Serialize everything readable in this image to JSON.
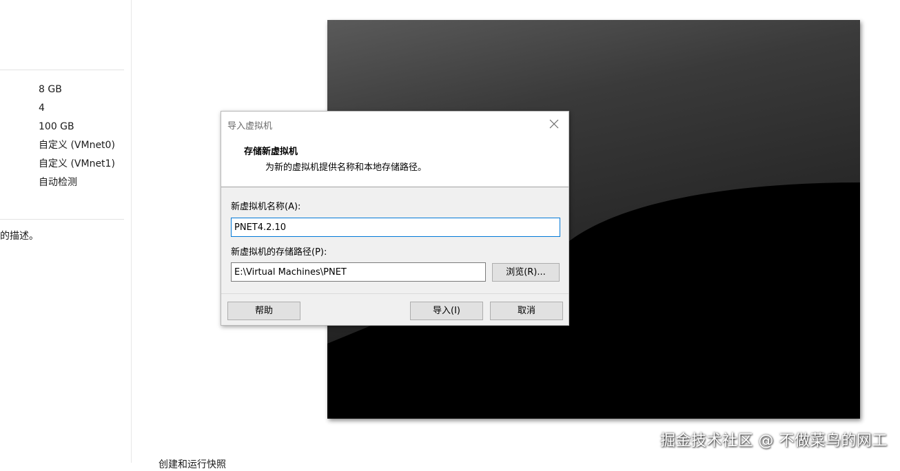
{
  "background_panel": {
    "specs": [
      "8 GB",
      "4",
      "100 GB",
      "自定义 (VMnet0)",
      "自定义 (VMnet1)",
      "自动检测"
    ],
    "description_fragment": "的描述。",
    "bottom_fragment": "创建和运行快照"
  },
  "vm_preview": {
    "icon": "vm-screen-preview"
  },
  "dialog": {
    "title": "导入虚拟机",
    "heading": "存储新虚拟机",
    "subheading": "为新的虚拟机提供名称和本地存储路径。",
    "name_label": "新虚拟机名称(A):",
    "name_value": "PNET4.2.10",
    "path_label": "新虚拟机的存储路径(P):",
    "path_value": "E:\\Virtual Machines\\PNET",
    "browse_label": "浏览(R)...",
    "help_label": "帮助",
    "import_label": "导入(I)",
    "cancel_label": "取消",
    "close_icon": "close-icon"
  },
  "watermark": "掘金技术社区 @ 不做菜鸟的网工",
  "colors": {
    "dialog_bg": "#f0f0f0",
    "focus_border": "#0078d7",
    "button_bg": "#e1e1e1"
  }
}
